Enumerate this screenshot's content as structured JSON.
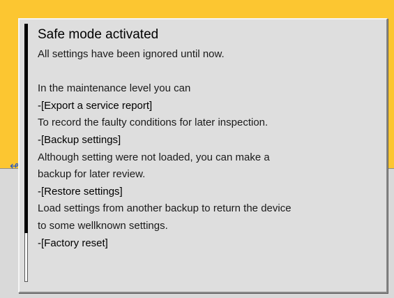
{
  "dialog": {
    "title": "Safe mode activated",
    "intro": "All settings have been ignored until now.",
    "lead": "In the maintenance level you can",
    "items": [
      {
        "label": "-[Export a service report]",
        "description": [
          "To record the faulty conditions for later inspection."
        ]
      },
      {
        "label": "-[Backup settings]",
        "description": [
          "Although setting were not loaded, you can make a",
          "backup for later review."
        ]
      },
      {
        "label": "-[Restore settings]",
        "description": [
          "Load settings from another backup to return the device",
          "to some wellknown settings."
        ]
      },
      {
        "label": "-[Factory reset]",
        "description": []
      }
    ]
  },
  "colors": {
    "background_top": "#fcc631",
    "background_bottom": "#d9d9d9",
    "dialog_bg": "#dedede",
    "scroll_thumb": "#000000"
  },
  "icons": {
    "background_edge_icon": "usb-icon"
  },
  "scroll": {
    "position_fraction": 0.0,
    "visible_fraction": 0.81
  }
}
